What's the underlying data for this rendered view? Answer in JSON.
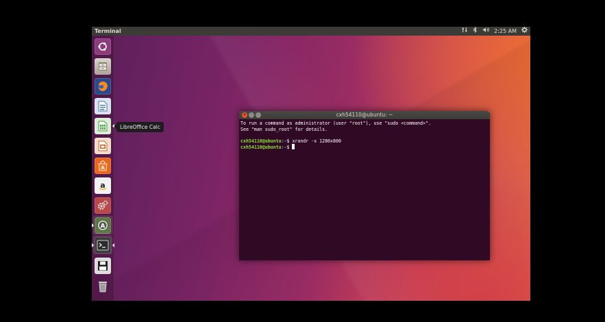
{
  "top_panel": {
    "app_title": "Terminal",
    "clock": "2:25 AM",
    "icons": [
      "network-icon",
      "bluetooth-icon",
      "volume-icon",
      "settings-gear-icon"
    ]
  },
  "launcher": {
    "items": [
      {
        "name": "ubuntu-dash",
        "icon": "ubuntu-logo-icon"
      },
      {
        "name": "files",
        "icon": "file-cabinet-icon"
      },
      {
        "name": "firefox",
        "icon": "firefox-icon"
      },
      {
        "name": "libreoffice-writer",
        "icon": "writer-document-icon"
      },
      {
        "name": "libreoffice-calc",
        "icon": "calc-spreadsheet-icon"
      },
      {
        "name": "libreoffice-impress",
        "icon": "impress-presentation-icon"
      },
      {
        "name": "ubuntu-software",
        "icon": "software-bag-icon"
      },
      {
        "name": "amazon",
        "icon": "amazon-icon"
      },
      {
        "name": "system-settings",
        "icon": "settings-gears-icon"
      },
      {
        "name": "software-updater",
        "icon": "updater-icon"
      },
      {
        "name": "terminal",
        "icon": "terminal-icon"
      },
      {
        "name": "save",
        "icon": "floppy-disk-icon"
      },
      {
        "name": "trash",
        "icon": "trash-icon"
      }
    ],
    "tooltip": "LibreOffice Calc"
  },
  "terminal": {
    "window_title": "cxh54110@ubuntu: ~",
    "sudo_line1": "To run a command as administrator (user \"root\"), use \"sudo <command>\".",
    "sudo_line2": "See \"man sudo_root\" for details.",
    "prompt_user": "cxh54110@ubuntu",
    "prompt_path": ":~",
    "prompt_symbol": "$ ",
    "command1": "xrandr -s 1280x800"
  },
  "colors": {
    "terminal_bg": "#300a24",
    "prompt_green": "#8ae234",
    "prompt_blue": "#729fcf",
    "panel_bg": "#3c3b37"
  }
}
